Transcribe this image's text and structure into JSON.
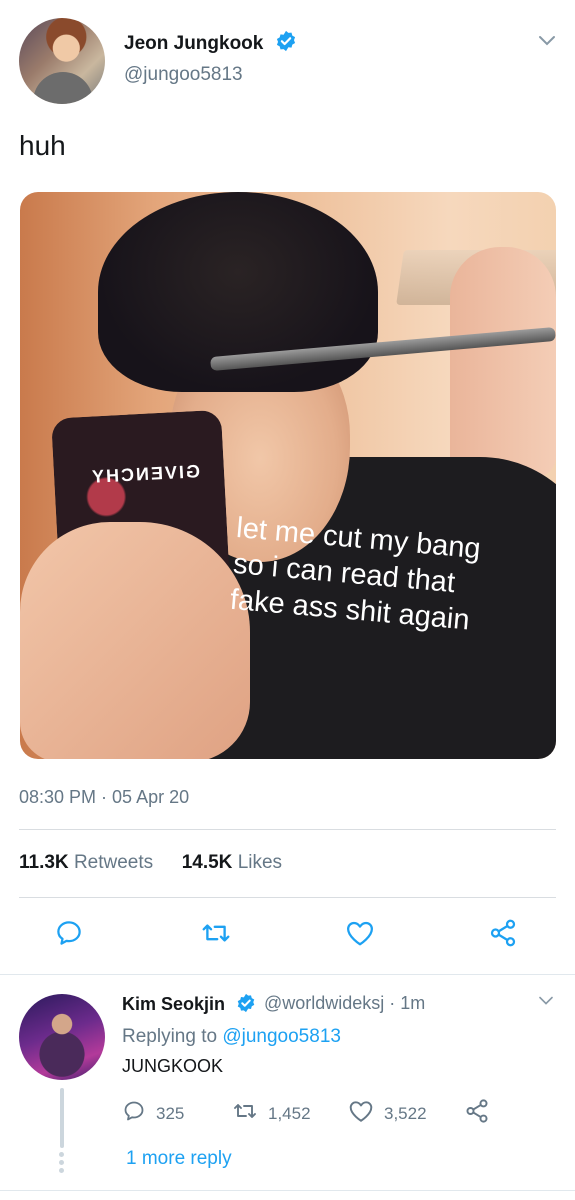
{
  "tweet": {
    "author_name": "Jeon Jungkook",
    "author_handle": "@jungoo5813",
    "text": "huh",
    "media": {
      "phone_brand": "GIVENCHY",
      "caption": "let me cut my bang\nso i can read that\nfake ass shit again"
    },
    "timestamp": "08:30 PM · 05 Apr 20",
    "retweets_count": "11.3K",
    "retweets_label": "Retweets",
    "likes_count": "14.5K",
    "likes_label": "Likes"
  },
  "reply": {
    "author_name": "Kim Seokjin",
    "author_handle_time": "@worldwideksj · 1m",
    "replying_prefix": "Replying to",
    "replying_to": "@jungoo5813",
    "text": "JUNGKOOK",
    "reply_count": "325",
    "retweet_count": "1,452",
    "like_count": "3,522",
    "more_replies": "1 more reply"
  },
  "colors": {
    "accent": "#1da1f2",
    "secondary_text": "#657786",
    "divider": "#e1e8ed"
  },
  "icons": [
    "chevron-down-icon",
    "verified-badge-icon",
    "reply-icon",
    "retweet-icon",
    "like-icon",
    "share-icon"
  ]
}
